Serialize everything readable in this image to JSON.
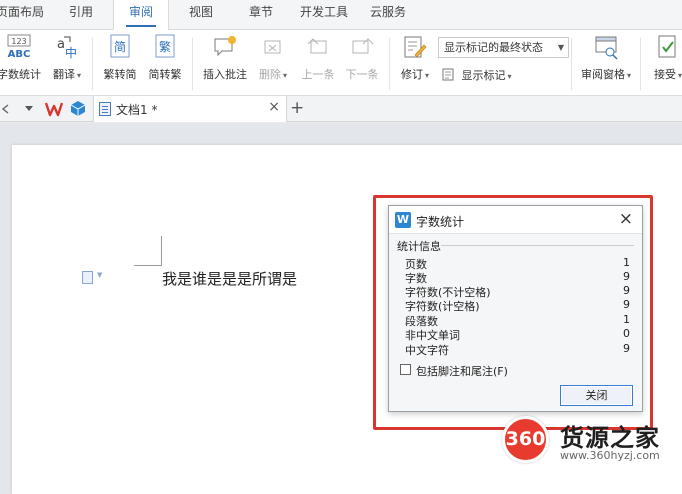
{
  "tabs": [
    {
      "label": "页面布局",
      "active": false
    },
    {
      "label": "引用",
      "active": false
    },
    {
      "label": "审阅",
      "active": true
    },
    {
      "label": "视图",
      "active": false
    },
    {
      "label": "章节",
      "active": false
    },
    {
      "label": "开发工具",
      "active": false
    },
    {
      "label": "云服务",
      "active": false
    }
  ],
  "ribbon": {
    "word_count": "字数统计",
    "translate": "翻译",
    "to_traditional": "繁转简",
    "to_simplified": "简转繁",
    "insert_comment": "插入批注",
    "delete": "删除",
    "previous": "上一条",
    "next": "下一条",
    "revision": "修订",
    "markup_state": "显示标记的最终状态",
    "show_markup": "显示标记",
    "review_pane": "审阅窗格",
    "accept": "接受"
  },
  "doc_tab": {
    "label": "文档1 *",
    "close": "×",
    "new": "+"
  },
  "document": {
    "body_text": "我是谁是是是所谓是"
  },
  "dialog": {
    "title": "字数统计",
    "close": "×",
    "group_label": "统计信息",
    "stats": [
      {
        "label": "页数",
        "value": "1"
      },
      {
        "label": "字数",
        "value": "9"
      },
      {
        "label": "字符数(不计空格)",
        "value": "9"
      },
      {
        "label": "字符数(计空格)",
        "value": "9"
      },
      {
        "label": "段落数",
        "value": "1"
      },
      {
        "label": "非中文单词",
        "value": "0"
      },
      {
        "label": "中文字符",
        "value": "9"
      }
    ],
    "include_footnotes": "包括脚注和尾注(F)",
    "include_footnotes_checked": false,
    "close_button": "关闭"
  },
  "watermark": {
    "badge": "360",
    "name": "货源之家",
    "url": "www.360hyzj.com"
  },
  "colors": {
    "accent": "#2f6fb8",
    "highlight": "#d9362f",
    "brand_red": "#e83b2f"
  }
}
